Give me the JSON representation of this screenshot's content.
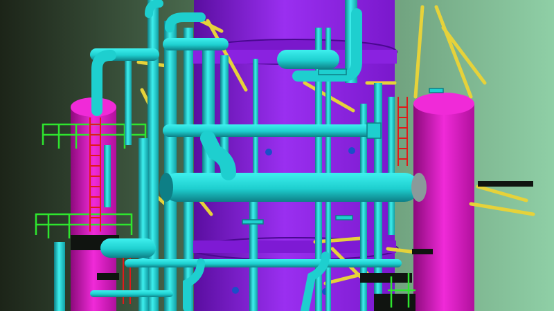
{
  "scene": {
    "description_label": "",
    "colors": {
      "background_dark": "#1c2418",
      "background_light": "#8fcfa6",
      "column_main": "#8a1fe0",
      "column_main_shade": "#5a0ea0",
      "vessel_magenta": "#e01ac8",
      "vessel_magenta_shade": "#8c0a7c",
      "pipe_cyan": "#1ecfcf",
      "pipe_cyan_shade": "#0d7f86",
      "pipe_grey": "#8a9a9a",
      "structure_yellow": "#e6d23a",
      "structure_green": "#2ee62e",
      "structure_red": "#e01a1a",
      "nozzle_blue": "#1a4fc8",
      "dark_platform": "#101410"
    },
    "objects": [
      "fractionation-column",
      "left-vessel",
      "right-vessel",
      "cyan-piping",
      "ladders",
      "handrails",
      "support-beams"
    ]
  }
}
